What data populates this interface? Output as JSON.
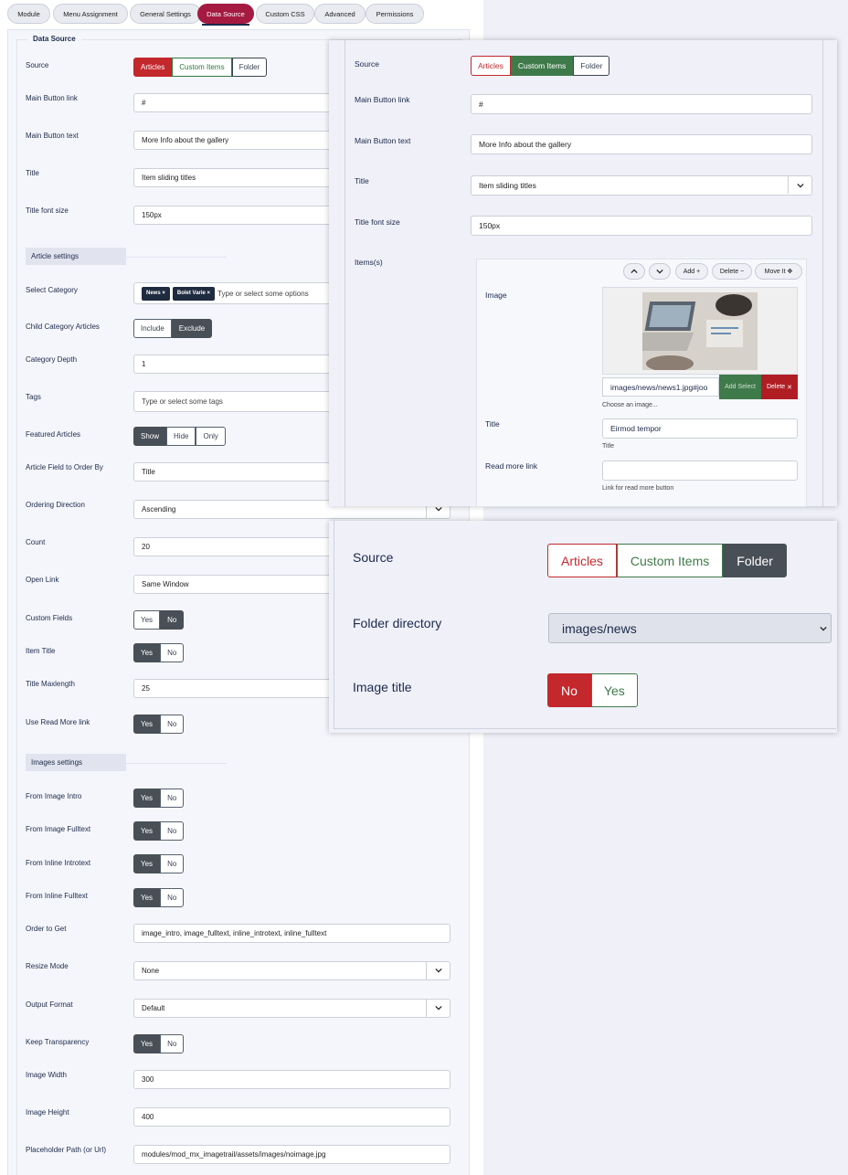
{
  "tabs": [
    "Module",
    "Menu Assignment",
    "General Settings",
    "Data Source",
    "Custom CSS",
    "Advanced",
    "Permissions"
  ],
  "legend": "Data Source",
  "source": {
    "label": "Source",
    "options": [
      "Articles",
      "Custom Items",
      "Folder"
    ]
  },
  "main_button_link": {
    "label": "Main Button link",
    "value": "#"
  },
  "main_button_text": {
    "label": "Main Button text",
    "value": "More Info about the gallery"
  },
  "title": {
    "label": "Title",
    "value": "Item sliding titles"
  },
  "title_font_size": {
    "label": "Title font size",
    "value": "150px"
  },
  "article_settings": "Article settings",
  "select_category": {
    "label": "Select Category",
    "chips": [
      "News",
      "Bolet Varie"
    ],
    "placeholder": "Type or select some options"
  },
  "child_category": {
    "label": "Child Category Articles",
    "options": [
      "Include",
      "Exclude"
    ]
  },
  "category_depth": {
    "label": "Category Depth",
    "value": "1"
  },
  "tags": {
    "label": "Tags",
    "placeholder": "Type or select some tags"
  },
  "featured": {
    "label": "Featured Articles",
    "options": [
      "Show",
      "Hide",
      "Only"
    ]
  },
  "order_by": {
    "label": "Article Field to Order By",
    "value": "Title"
  },
  "ordering_direction": {
    "label": "Ordering Direction",
    "value": "Ascending"
  },
  "count": {
    "label": "Count",
    "value": "20"
  },
  "open_link": {
    "label": "Open Link",
    "value": "Same Window"
  },
  "custom_fields": {
    "label": "Custom Fields",
    "options": [
      "Yes",
      "No"
    ]
  },
  "item_title": {
    "label": "Item Title",
    "options": [
      "Yes",
      "No"
    ]
  },
  "title_maxlength": {
    "label": "Title Maxlength",
    "value": "25"
  },
  "use_read_more": {
    "label": "Use Read More link",
    "options": [
      "Yes",
      "No"
    ]
  },
  "images_settings": "Images settings",
  "from_image_intro": {
    "label": "From Image Intro",
    "options": [
      "Yes",
      "No"
    ]
  },
  "from_image_fulltext": {
    "label": "From Image Fulltext",
    "options": [
      "Yes",
      "No"
    ]
  },
  "from_inline_introtext": {
    "label": "From Inline Introtext",
    "options": [
      "Yes",
      "No"
    ]
  },
  "from_inline_fulltext": {
    "label": "From Inline Fulltext",
    "options": [
      "Yes",
      "No"
    ]
  },
  "order_to_get": {
    "label": "Order to Get",
    "value": "image_intro, image_fulltext, inline_introtext, inline_fulltext"
  },
  "resize_mode": {
    "label": "Resize Mode",
    "value": "None"
  },
  "output_format": {
    "label": "Output Format",
    "value": "Default"
  },
  "keep_transparency": {
    "label": "Keep Transparency",
    "options": [
      "Yes",
      "No"
    ]
  },
  "image_width": {
    "label": "Image Width",
    "value": "300"
  },
  "image_height": {
    "label": "Image Height",
    "value": "400"
  },
  "placeholder_path": {
    "label": "Placeholder Path (or Url)",
    "value": "modules/mod_mx_imagetrail/assets/images/noimage.jpg"
  },
  "overlay1": {
    "items_label": "Items(s)",
    "toolbar": {
      "add": "Add",
      "delete": "Delete",
      "move": "Move It"
    },
    "image_label": "Image",
    "image_path": "images/news/news1.jpg#joo",
    "add_select": "Add Select",
    "delete_x": "Delete",
    "choose_image": "Choose an image...",
    "item_title_label": "Title",
    "item_title_value": "Eirmod tempor",
    "item_title_hint": "Title",
    "read_more_label": "Read more link",
    "read_more_hint": "Link for read more button"
  },
  "overlay2": {
    "source_label": "Source",
    "folder_label": "Folder directory",
    "folder_value": "images/news",
    "image_title_label": "Image title",
    "image_title_options": [
      "No",
      "Yes"
    ]
  }
}
